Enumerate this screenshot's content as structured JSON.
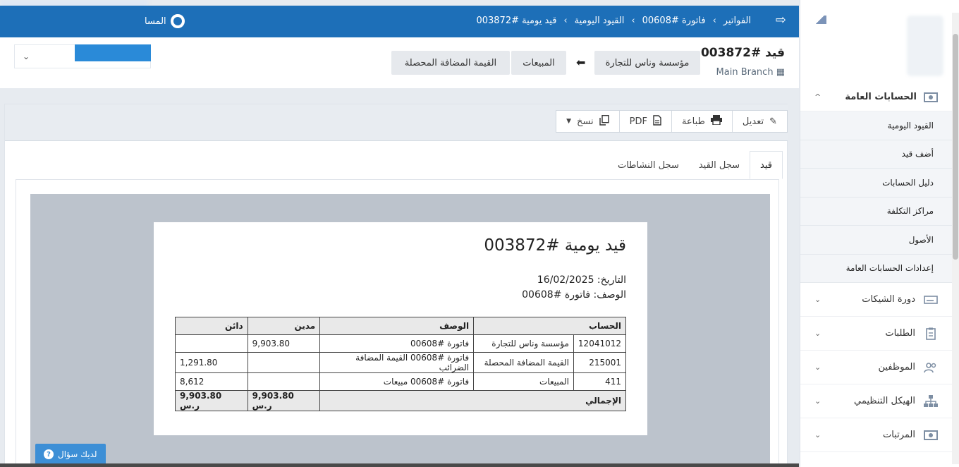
{
  "topbar": {
    "breadcrumbs": [
      "الفواتير",
      "فاتورة #00608",
      "القيود اليومية",
      "قيد يومية #003872"
    ],
    "help_label": "المسا"
  },
  "header": {
    "title": "قيد #003872",
    "branch": "Main Branch",
    "pills": {
      "company": "مؤسسة وناس للتجارة",
      "sales": "المبيعات",
      "vat": "القيمة المضافة المحصلة"
    }
  },
  "toolbar": {
    "edit": "تعديل",
    "print": "طباعة",
    "pdf": "PDF",
    "copy": "نسخ"
  },
  "tabs": [
    "قيد",
    "سجل القيد",
    "سجل النشاطات"
  ],
  "document": {
    "title": "قيد يومية #003872",
    "date_line": "التاريخ: 16/02/2025",
    "desc_line": "الوصف: فاتورة #00608",
    "columns": [
      "الحساب",
      "الوصف",
      "مدين",
      "دائن"
    ],
    "rows": [
      {
        "code": "12041012",
        "account": "مؤسسة وناس للتجارة",
        "desc": "فاتورة #00608",
        "debit": "9,903.80",
        "credit": ""
      },
      {
        "code": "215001",
        "account": "القيمة المضافة المحصلة",
        "desc": "فاتورة #00608 القيمة المضافة الضرائب",
        "debit": "",
        "credit": "1,291.80"
      },
      {
        "code": "411",
        "account": "المبيعات",
        "desc": "فاتورة #00608 مبيعات",
        "debit": "",
        "credit": "8,612"
      }
    ],
    "total_label": "الإجمالي",
    "total_debit": "9,903.80 ر.س",
    "total_credit": "9,903.80 ر.س"
  },
  "sidebar": {
    "open_group": "الحسابات العامة",
    "sub_items": [
      "القيود اليومية",
      "أضف قيد",
      "دليل الحسابات",
      "مراكز التكلفة",
      "الأصول",
      "إعدادات الحسابات العامة"
    ],
    "groups": [
      "دورة الشيكات",
      "الطلبات",
      "الموظفين",
      "الهيكل التنظيمي",
      "المرتبات"
    ]
  },
  "question_button": "لديك سؤال"
}
